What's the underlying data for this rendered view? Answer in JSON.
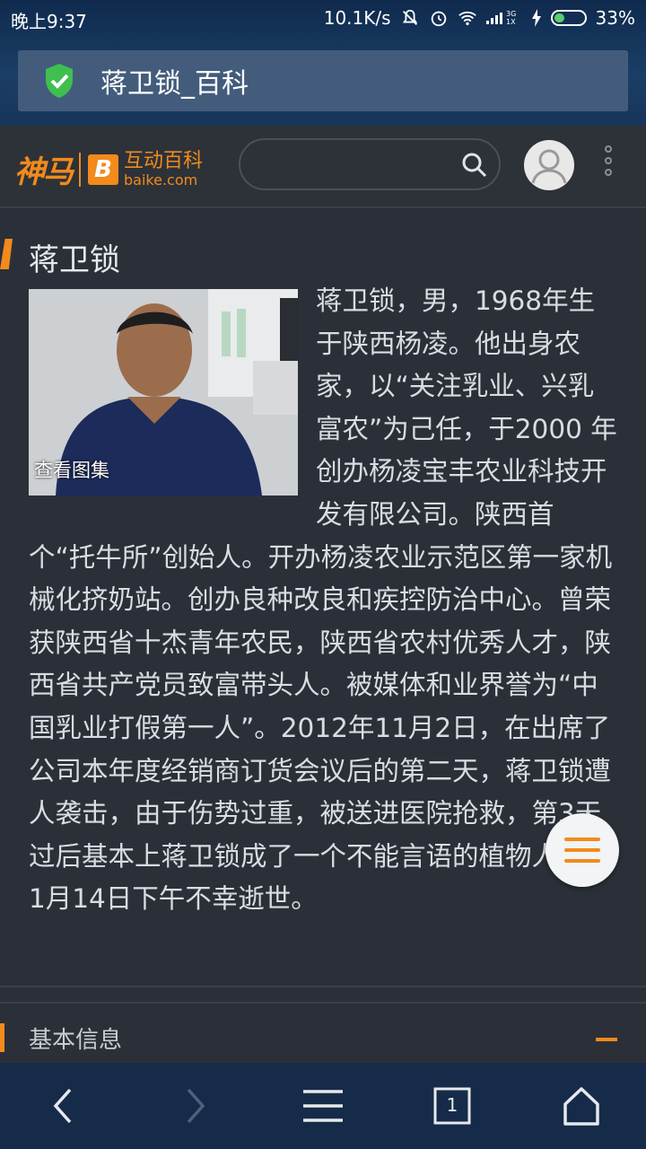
{
  "status_bar": {
    "time": "晚上9:37",
    "speed": "10.1K/s",
    "network": "3G",
    "battery_percent": "33%",
    "battery_level": 0.33
  },
  "address_bar": {
    "title": "蒋卫锁_百科"
  },
  "header": {
    "logo_primary": "神马",
    "logo_brand": "互动百科",
    "logo_domain": "baike.com",
    "logo_badge": "B"
  },
  "article": {
    "title": "蒋卫锁",
    "photo_caption": "查看图集",
    "body": "蒋卫锁，男，1968年生于陕西杨凌。他出身农家，以“关注乳业、兴乳富农”为己任，于2000 年创办杨凌宝丰农业科技开发有限公司。陕西首个“托牛所”创始人。开办杨凌农业示范区第一家机械化挤奶站。创办良种改良和疾控防治中心。曾荣获陕西省十杰青年农民，陕西省农村优秀人才，陕西省共产党员致富带头人。被媒体和业界誉为“中国乳业打假第一人”。2012年11月2日，在出席了公司本年度经销商订货会议后的第二天，蒋卫锁遭人袭击，由于伤势过重，被送进医院抢救，第3天过后基本上蒋卫锁成了一个不能言语的植物人，11月14日下午不幸逝世。"
  },
  "section": {
    "basic_info_label": "基本信息"
  },
  "bottom_nav": {
    "tab_count": "1"
  },
  "colors": {
    "accent": "#f28a1c",
    "background": "#2b3038",
    "nav_background": "#152b49"
  }
}
